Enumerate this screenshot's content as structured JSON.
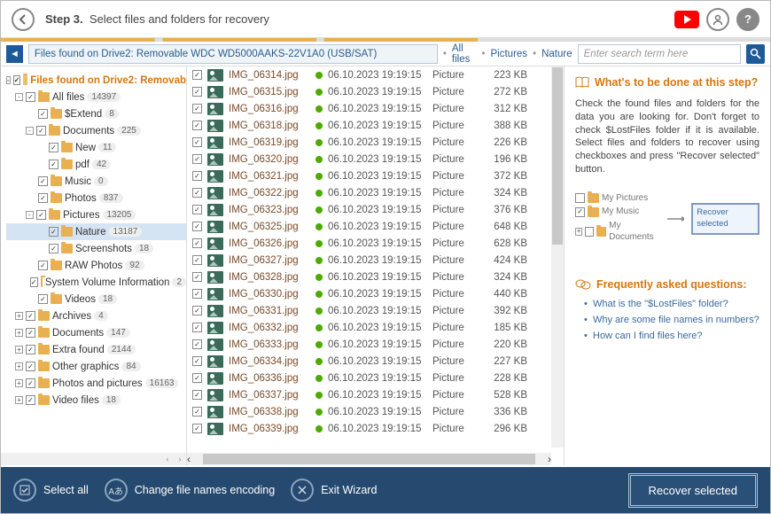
{
  "header": {
    "step_label": "Step 3.",
    "step_desc": "Select files and folders for recovery"
  },
  "path": {
    "location": "Files found on Drive2: Removable WDC WD5000AAKS-22V1A0 (USB/SAT)",
    "crumbs": [
      "All files",
      "Pictures",
      "Nature"
    ]
  },
  "search": {
    "placeholder": "Enter search term here"
  },
  "tree": {
    "root": {
      "label": "Files found on Drive2: Removab"
    },
    "items": [
      {
        "label": "All files",
        "count": "14397",
        "ind": 1,
        "exp": "-",
        "sel": false
      },
      {
        "label": "$Extend",
        "count": "8",
        "ind": 2,
        "exp": "",
        "sel": false
      },
      {
        "label": "Documents",
        "count": "225",
        "ind": 2,
        "exp": "-",
        "sel": false
      },
      {
        "label": "New",
        "count": "11",
        "ind": 3,
        "exp": "",
        "sel": false
      },
      {
        "label": "pdf",
        "count": "42",
        "ind": 3,
        "exp": "",
        "sel": false
      },
      {
        "label": "Music",
        "count": "0",
        "ind": 2,
        "exp": "",
        "sel": false
      },
      {
        "label": "Photos",
        "count": "837",
        "ind": 2,
        "exp": "",
        "sel": false
      },
      {
        "label": "Pictures",
        "count": "13205",
        "ind": 2,
        "exp": "-",
        "sel": false
      },
      {
        "label": "Nature",
        "count": "13187",
        "ind": 3,
        "exp": "",
        "sel": true
      },
      {
        "label": "Screenshots",
        "count": "18",
        "ind": 3,
        "exp": "",
        "sel": false
      },
      {
        "label": "RAW Photos",
        "count": "92",
        "ind": 2,
        "exp": "",
        "sel": false
      },
      {
        "label": "System Volume Information",
        "count": "2",
        "ind": 2,
        "exp": "",
        "sel": false
      },
      {
        "label": "Videos",
        "count": "18",
        "ind": 2,
        "exp": "",
        "sel": false
      },
      {
        "label": "Archives",
        "count": "4",
        "ind": 1,
        "exp": "+",
        "sel": false
      },
      {
        "label": "Documents",
        "count": "147",
        "ind": 1,
        "exp": "+",
        "sel": false
      },
      {
        "label": "Extra found",
        "count": "2144",
        "ind": 1,
        "exp": "+",
        "sel": false
      },
      {
        "label": "Other graphics",
        "count": "84",
        "ind": 1,
        "exp": "+",
        "sel": false
      },
      {
        "label": "Photos and pictures",
        "count": "16163",
        "ind": 1,
        "exp": "+",
        "sel": false
      },
      {
        "label": "Video files",
        "count": "18",
        "ind": 1,
        "exp": "+",
        "sel": false
      }
    ]
  },
  "files": [
    {
      "name": "IMG_06314.jpg",
      "date": "06.10.2023 19:19:15",
      "type": "Picture",
      "size": "223 KB"
    },
    {
      "name": "IMG_06315.jpg",
      "date": "06.10.2023 19:19:15",
      "type": "Picture",
      "size": "272 KB"
    },
    {
      "name": "IMG_06316.jpg",
      "date": "06.10.2023 19:19:15",
      "type": "Picture",
      "size": "312 KB"
    },
    {
      "name": "IMG_06318.jpg",
      "date": "06.10.2023 19:19:15",
      "type": "Picture",
      "size": "388 KB"
    },
    {
      "name": "IMG_06319.jpg",
      "date": "06.10.2023 19:19:15",
      "type": "Picture",
      "size": "226 KB"
    },
    {
      "name": "IMG_06320.jpg",
      "date": "06.10.2023 19:19:15",
      "type": "Picture",
      "size": "196 KB"
    },
    {
      "name": "IMG_06321.jpg",
      "date": "06.10.2023 19:19:15",
      "type": "Picture",
      "size": "372 KB"
    },
    {
      "name": "IMG_06322.jpg",
      "date": "06.10.2023 19:19:15",
      "type": "Picture",
      "size": "324 KB"
    },
    {
      "name": "IMG_06323.jpg",
      "date": "06.10.2023 19:19:15",
      "type": "Picture",
      "size": "376 KB"
    },
    {
      "name": "IMG_06325.jpg",
      "date": "06.10.2023 19:19:15",
      "type": "Picture",
      "size": "648 KB"
    },
    {
      "name": "IMG_06326.jpg",
      "date": "06.10.2023 19:19:15",
      "type": "Picture",
      "size": "628 KB"
    },
    {
      "name": "IMG_06327.jpg",
      "date": "06.10.2023 19:19:15",
      "type": "Picture",
      "size": "424 KB"
    },
    {
      "name": "IMG_06328.jpg",
      "date": "06.10.2023 19:19:15",
      "type": "Picture",
      "size": "324 KB"
    },
    {
      "name": "IMG_06330.jpg",
      "date": "06.10.2023 19:19:15",
      "type": "Picture",
      "size": "440 KB"
    },
    {
      "name": "IMG_06331.jpg",
      "date": "06.10.2023 19:19:15",
      "type": "Picture",
      "size": "392 KB"
    },
    {
      "name": "IMG_06332.jpg",
      "date": "06.10.2023 19:19:15",
      "type": "Picture",
      "size": "185 KB"
    },
    {
      "name": "IMG_06333.jpg",
      "date": "06.10.2023 19:19:15",
      "type": "Picture",
      "size": "220 KB"
    },
    {
      "name": "IMG_06334.jpg",
      "date": "06.10.2023 19:19:15",
      "type": "Picture",
      "size": "227 KB"
    },
    {
      "name": "IMG_06336.jpg",
      "date": "06.10.2023 19:19:15",
      "type": "Picture",
      "size": "228 KB"
    },
    {
      "name": "IMG_06337.jpg",
      "date": "06.10.2023 19:19:15",
      "type": "Picture",
      "size": "528 KB"
    },
    {
      "name": "IMG_06338.jpg",
      "date": "06.10.2023 19:19:15",
      "type": "Picture",
      "size": "336 KB"
    },
    {
      "name": "IMG_06339.jpg",
      "date": "06.10.2023 19:19:15",
      "type": "Picture",
      "size": "296 KB"
    }
  ],
  "help": {
    "title": "What's to be done at this step?",
    "body": "Check the found files and folders for the data you are looking for. Don't forget to check $LostFiles folder if it is available. Select files and folders to recover using checkboxes and press \"Recover selected\" button.",
    "dia_items": [
      "My Pictures",
      "My Music",
      "My Documents"
    ],
    "dia_btn": "Recover selected",
    "faq_title": "Frequently asked questions:",
    "faq": [
      "What is the \"$LostFiles\" folder?",
      "Why are some file names in numbers?",
      "How can I find files here?"
    ]
  },
  "bottom": {
    "select_all": "Select all",
    "encoding": "Change file names encoding",
    "exit": "Exit Wizard",
    "recover": "Recover selected"
  }
}
